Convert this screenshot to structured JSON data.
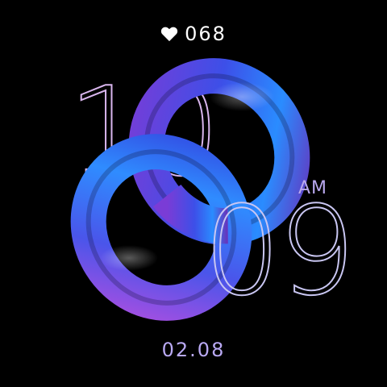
{
  "heart_rate": {
    "icon": "heart-icon",
    "value": "068"
  },
  "time": {
    "hour": "10",
    "minute": "09",
    "period": "AM"
  },
  "date": "02.08",
  "colors": {
    "background": "#000000",
    "digit_outline": "#d9b6ee",
    "accent": "#b9a9f3",
    "ring_blue": "#2f6bff",
    "ring_purple": "#8a3ed8"
  }
}
